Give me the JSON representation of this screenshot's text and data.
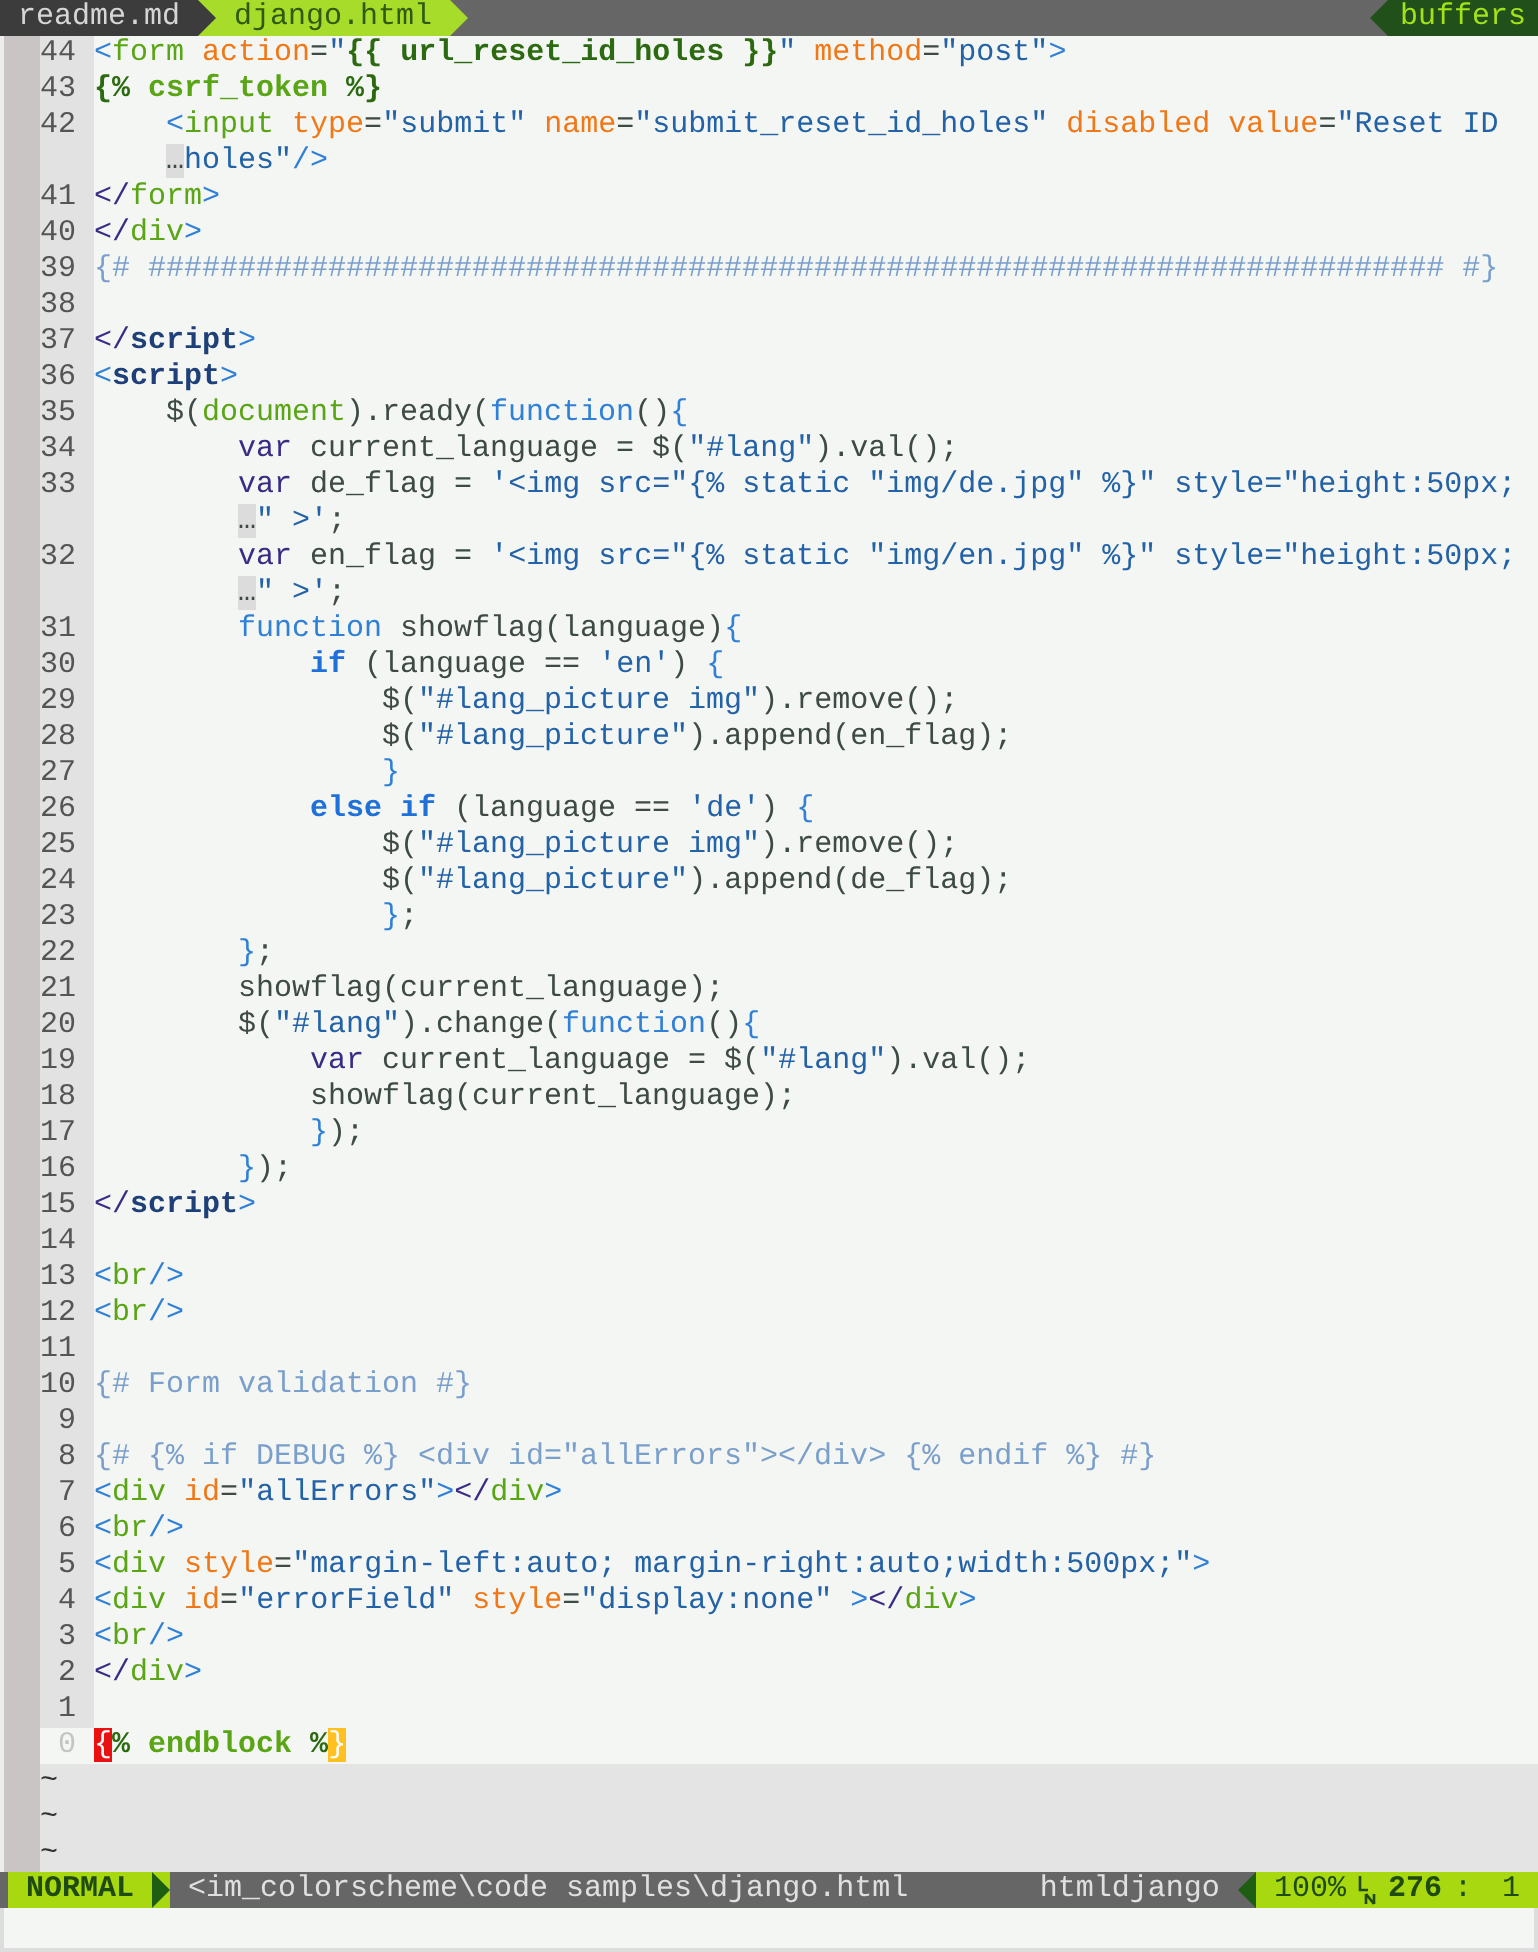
{
  "tabline": {
    "tabs": [
      {
        "label": "readme.md",
        "selected": false
      },
      {
        "label": "django.html",
        "selected": true
      }
    ],
    "buffers_label": "buffers"
  },
  "lines": [
    {
      "number": "44",
      "current": false,
      "segments": [
        {
          "text": "<",
          "kind": "punct"
        },
        {
          "text": "form",
          "kind": "tag"
        },
        {
          "text": " action",
          "kind": "attr"
        },
        {
          "text": "=",
          "kind": "plain"
        },
        {
          "text": "\"",
          "kind": "str"
        },
        {
          "text": "{{ url_reset_id_holes }}",
          "kind": "tpl"
        },
        {
          "text": "\"",
          "kind": "str"
        },
        {
          "text": " method",
          "kind": "attr"
        },
        {
          "text": "=",
          "kind": "plain"
        },
        {
          "text": "\"post\"",
          "kind": "str"
        },
        {
          "text": ">",
          "kind": "punct"
        }
      ]
    },
    {
      "number": "43",
      "current": false,
      "segments": [
        {
          "text": "{%",
          "kind": "tpl"
        },
        {
          "text": " csrf_token",
          "kind": "tplname"
        },
        {
          "text": " %}",
          "kind": "tpl"
        }
      ]
    },
    {
      "number": "42",
      "current": false,
      "segments": [
        {
          "text": "    <",
          "kind": "punct"
        },
        {
          "text": "input",
          "kind": "tag"
        },
        {
          "text": " type",
          "kind": "attr"
        },
        {
          "text": "=",
          "kind": "plain"
        },
        {
          "text": "\"submit\"",
          "kind": "str"
        },
        {
          "text": " name",
          "kind": "attr"
        },
        {
          "text": "=",
          "kind": "plain"
        },
        {
          "text": "\"submit_reset_id_holes\"",
          "kind": "str"
        },
        {
          "text": " disabled value",
          "kind": "attr"
        },
        {
          "text": "=",
          "kind": "plain"
        },
        {
          "text": "\"Reset ID",
          "kind": "str"
        }
      ]
    },
    {
      "current": false,
      "segments": [
        {
          "text": "…",
          "kind": "wrap"
        },
        {
          "text": "holes\"",
          "kind": "str"
        },
        {
          "text": "/>",
          "kind": "punct"
        }
      ]
    },
    {
      "number": "41",
      "current": false,
      "segments": [
        {
          "text": "</",
          "kind": "close"
        },
        {
          "text": "form",
          "kind": "tag"
        },
        {
          "text": ">",
          "kind": "punct"
        }
      ]
    },
    {
      "number": "40",
      "current": false,
      "segments": [
        {
          "text": "</",
          "kind": "close"
        },
        {
          "text": "div",
          "kind": "tag"
        },
        {
          "text": ">",
          "kind": "punct"
        }
      ]
    },
    {
      "number": "39",
      "current": false,
      "segments": [
        {
          "text": "{# ######################################################################## #}",
          "kind": "comment"
        }
      ]
    },
    {
      "number": "38",
      "current": false
    },
    {
      "number": "37",
      "current": false,
      "segments": [
        {
          "text": "</",
          "kind": "close"
        },
        {
          "text": "script",
          "kind": "tagbold"
        },
        {
          "text": ">",
          "kind": "punct"
        }
      ]
    },
    {
      "number": "36",
      "current": false,
      "segments": [
        {
          "text": "<",
          "kind": "punct"
        },
        {
          "text": "script",
          "kind": "tagbold"
        },
        {
          "text": ">",
          "kind": "punct"
        }
      ]
    },
    {
      "number": "35",
      "current": false,
      "segments": [
        {
          "text": "    $(",
          "kind": "plain"
        },
        {
          "text": "document",
          "kind": "tag"
        },
        {
          "text": ").ready(",
          "kind": "plain"
        },
        {
          "text": "function",
          "kind": "kw"
        },
        {
          "text": "()",
          "kind": "plain"
        },
        {
          "text": "{",
          "kind": "punct"
        }
      ]
    },
    {
      "number": "34",
      "current": false,
      "segments": [
        {
          "text": "        var",
          "kind": "var"
        },
        {
          "text": " current_language = $(",
          "kind": "plain"
        },
        {
          "text": "\"#lang\"",
          "kind": "str"
        },
        {
          "text": ").val();",
          "kind": "plain"
        }
      ]
    },
    {
      "number": "33",
      "current": false,
      "segments": [
        {
          "text": "        var",
          "kind": "var"
        },
        {
          "text": " de_flag = ",
          "kind": "plain"
        },
        {
          "text": "'<img src=\"{% static \"img/de.jpg\" %}\" style=\"height:50px;",
          "kind": "str"
        }
      ]
    },
    {
      "current": false,
      "segments": [
        {
          "text": "…",
          "kind": "wrap"
        },
        {
          "text": "\" >'",
          "kind": "str"
        },
        {
          "text": ";",
          "kind": "plain"
        }
      ]
    },
    {
      "number": "32",
      "current": false,
      "segments": [
        {
          "text": "        var",
          "kind": "var"
        },
        {
          "text": " en_flag = ",
          "kind": "plain"
        },
        {
          "text": "'<img src=\"{% static \"img/en.jpg\" %}\" style=\"height:50px;",
          "kind": "str"
        }
      ]
    },
    {
      "current": false,
      "segments": [
        {
          "text": "…",
          "kind": "wrap"
        },
        {
          "text": "\" >'",
          "kind": "str"
        },
        {
          "text": ";",
          "kind": "plain"
        }
      ]
    },
    {
      "number": "31",
      "current": false,
      "segments": [
        {
          "text": "        function",
          "kind": "kw"
        },
        {
          "text": " showflag(language)",
          "kind": "plain"
        },
        {
          "text": "{",
          "kind": "punct"
        }
      ]
    },
    {
      "number": "30",
      "current": false,
      "segments": [
        {
          "text": "            if",
          "kind": "kwbold"
        },
        {
          "text": " (language == ",
          "kind": "plain"
        },
        {
          "text": "'en'",
          "kind": "str"
        },
        {
          "text": ") ",
          "kind": "plain"
        },
        {
          "text": "{",
          "kind": "punct"
        }
      ]
    },
    {
      "number": "29",
      "current": false,
      "segments": [
        {
          "text": "                $(",
          "kind": "plain"
        },
        {
          "text": "\"#lang_picture img\"",
          "kind": "str"
        },
        {
          "text": ").remove();",
          "kind": "plain"
        }
      ]
    },
    {
      "number": "28",
      "current": false,
      "segments": [
        {
          "text": "                $(",
          "kind": "plain"
        },
        {
          "text": "\"#lang_picture\"",
          "kind": "str"
        },
        {
          "text": ").append(en_flag);",
          "kind": "plain"
        }
      ]
    },
    {
      "number": "27",
      "current": false,
      "segments": [
        {
          "text": "                }",
          "kind": "punct"
        }
      ]
    },
    {
      "number": "26",
      "current": false,
      "segments": [
        {
          "text": "            else if",
          "kind": "kwbold"
        },
        {
          "text": " (language == ",
          "kind": "plain"
        },
        {
          "text": "'de'",
          "kind": "str"
        },
        {
          "text": ") ",
          "kind": "plain"
        },
        {
          "text": "{",
          "kind": "punct"
        }
      ]
    },
    {
      "number": "25",
      "current": false,
      "segments": [
        {
          "text": "                $(",
          "kind": "plain"
        },
        {
          "text": "\"#lang_picture img\"",
          "kind": "str"
        },
        {
          "text": ").remove();",
          "kind": "plain"
        }
      ]
    },
    {
      "number": "24",
      "current": false,
      "segments": [
        {
          "text": "                $(",
          "kind": "plain"
        },
        {
          "text": "\"#lang_picture\"",
          "kind": "str"
        },
        {
          "text": ").append(de_flag);",
          "kind": "plain"
        }
      ]
    },
    {
      "number": "23",
      "current": false,
      "segments": [
        {
          "text": "                }",
          "kind": "punct"
        },
        {
          "text": ";",
          "kind": "plain"
        }
      ]
    },
    {
      "number": "22",
      "current": false,
      "segments": [
        {
          "text": "        }",
          "kind": "punct"
        },
        {
          "text": ";",
          "kind": "plain"
        }
      ]
    },
    {
      "number": "21",
      "current": false,
      "segments": [
        {
          "text": "        showflag(current_language);",
          "kind": "plain"
        }
      ]
    },
    {
      "number": "20",
      "current": false,
      "segments": [
        {
          "text": "        $(",
          "kind": "plain"
        },
        {
          "text": "\"#lang\"",
          "kind": "str"
        },
        {
          "text": ").change(",
          "kind": "plain"
        },
        {
          "text": "function",
          "kind": "kw"
        },
        {
          "text": "()",
          "kind": "plain"
        },
        {
          "text": "{",
          "kind": "punct"
        }
      ]
    },
    {
      "number": "19",
      "current": false,
      "segments": [
        {
          "text": "            var",
          "kind": "var"
        },
        {
          "text": " current_language = $(",
          "kind": "plain"
        },
        {
          "text": "\"#lang\"",
          "kind": "str"
        },
        {
          "text": ").val();",
          "kind": "plain"
        }
      ]
    },
    {
      "number": "18",
      "current": false,
      "segments": [
        {
          "text": "            showflag(current_language);",
          "kind": "plain"
        }
      ]
    },
    {
      "number": "17",
      "current": false,
      "segments": [
        {
          "text": "            }",
          "kind": "punct"
        },
        {
          "text": ");",
          "kind": "plain"
        }
      ]
    },
    {
      "number": "16",
      "current": false,
      "segments": [
        {
          "text": "        }",
          "kind": "punct"
        },
        {
          "text": ");",
          "kind": "plain"
        }
      ]
    },
    {
      "number": "15",
      "current": false,
      "segments": [
        {
          "text": "</",
          "kind": "close"
        },
        {
          "text": "script",
          "kind": "tagbold"
        },
        {
          "text": ">",
          "kind": "punct"
        }
      ]
    },
    {
      "number": "14",
      "current": false
    },
    {
      "number": "13",
      "current": false,
      "segments": [
        {
          "text": "<",
          "kind": "punct"
        },
        {
          "text": "br",
          "kind": "tag"
        },
        {
          "text": "/>",
          "kind": "punct"
        }
      ]
    },
    {
      "number": "12",
      "current": false,
      "segments": [
        {
          "text": "<",
          "kind": "punct"
        },
        {
          "text": "br",
          "kind": "tag"
        },
        {
          "text": "/>",
          "kind": "punct"
        }
      ]
    },
    {
      "number": "11",
      "current": false
    },
    {
      "number": "10",
      "current": false,
      "segments": [
        {
          "text": "{# Form validation #}",
          "kind": "comment"
        }
      ]
    },
    {
      "number": "9",
      "current": false
    },
    {
      "number": "8",
      "current": false,
      "segments": [
        {
          "text": "{# {% if DEBUG %} <div id=\"allErrors\"></div> {% endif %} #}",
          "kind": "comment"
        }
      ]
    },
    {
      "number": "7",
      "current": false,
      "segments": [
        {
          "text": "<",
          "kind": "punct"
        },
        {
          "text": "div",
          "kind": "tag"
        },
        {
          "text": " id",
          "kind": "attr"
        },
        {
          "text": "=",
          "kind": "plain"
        },
        {
          "text": "\"allErrors\"",
          "kind": "str"
        },
        {
          "text": ">",
          "kind": "punct"
        },
        {
          "text": "</",
          "kind": "close"
        },
        {
          "text": "div",
          "kind": "tag"
        },
        {
          "text": ">",
          "kind": "punct"
        }
      ]
    },
    {
      "number": "6",
      "current": false,
      "segments": [
        {
          "text": "<",
          "kind": "punct"
        },
        {
          "text": "br",
          "kind": "tag"
        },
        {
          "text": "/>",
          "kind": "punct"
        }
      ]
    },
    {
      "number": "5",
      "current": false,
      "segments": [
        {
          "text": "<",
          "kind": "punct"
        },
        {
          "text": "div",
          "kind": "tag"
        },
        {
          "text": " style",
          "kind": "attr"
        },
        {
          "text": "=",
          "kind": "plain"
        },
        {
          "text": "\"margin-left:auto; margin-right:auto;width:500px;\"",
          "kind": "str"
        },
        {
          "text": ">",
          "kind": "punct"
        }
      ]
    },
    {
      "number": "4",
      "current": false,
      "segments": [
        {
          "text": "<",
          "kind": "punct"
        },
        {
          "text": "div",
          "kind": "tag"
        },
        {
          "text": " id",
          "kind": "attr"
        },
        {
          "text": "=",
          "kind": "plain"
        },
        {
          "text": "\"errorField\"",
          "kind": "str"
        },
        {
          "text": " style",
          "kind": "attr"
        },
        {
          "text": "=",
          "kind": "plain"
        },
        {
          "text": "\"display:none\"",
          "kind": "str"
        },
        {
          "text": " >",
          "kind": "punct"
        },
        {
          "text": "</",
          "kind": "close"
        },
        {
          "text": "div",
          "kind": "tag"
        },
        {
          "text": ">",
          "kind": "punct"
        }
      ]
    },
    {
      "number": "3",
      "current": false,
      "segments": [
        {
          "text": "<",
          "kind": "punct"
        },
        {
          "text": "br",
          "kind": "tag"
        },
        {
          "text": "/>",
          "kind": "punct"
        }
      ]
    },
    {
      "number": "2",
      "current": false,
      "segments": [
        {
          "text": "</",
          "kind": "close"
        },
        {
          "text": "div",
          "kind": "tag"
        },
        {
          "text": ">",
          "kind": "punct"
        }
      ]
    },
    {
      "number": "1",
      "current": false
    },
    {
      "number": "0",
      "current": true,
      "segments": [
        {
          "text": "{",
          "kind": "err"
        },
        {
          "text": "%",
          "kind": "tpl"
        },
        {
          "text": " endblock ",
          "kind": "tplname"
        },
        {
          "text": "%",
          "kind": "tpl"
        },
        {
          "text": "}",
          "kind": "match"
        }
      ]
    }
  ],
  "filler": [
    "~",
    "~",
    "~"
  ],
  "status_bar": {
    "mode": "NORMAL",
    "path": "<im_colorscheme\\code samples\\django.html",
    "filetype": "htmldjango",
    "percent": "100%",
    "line": "276",
    "separator": ":",
    "column": "1"
  }
}
